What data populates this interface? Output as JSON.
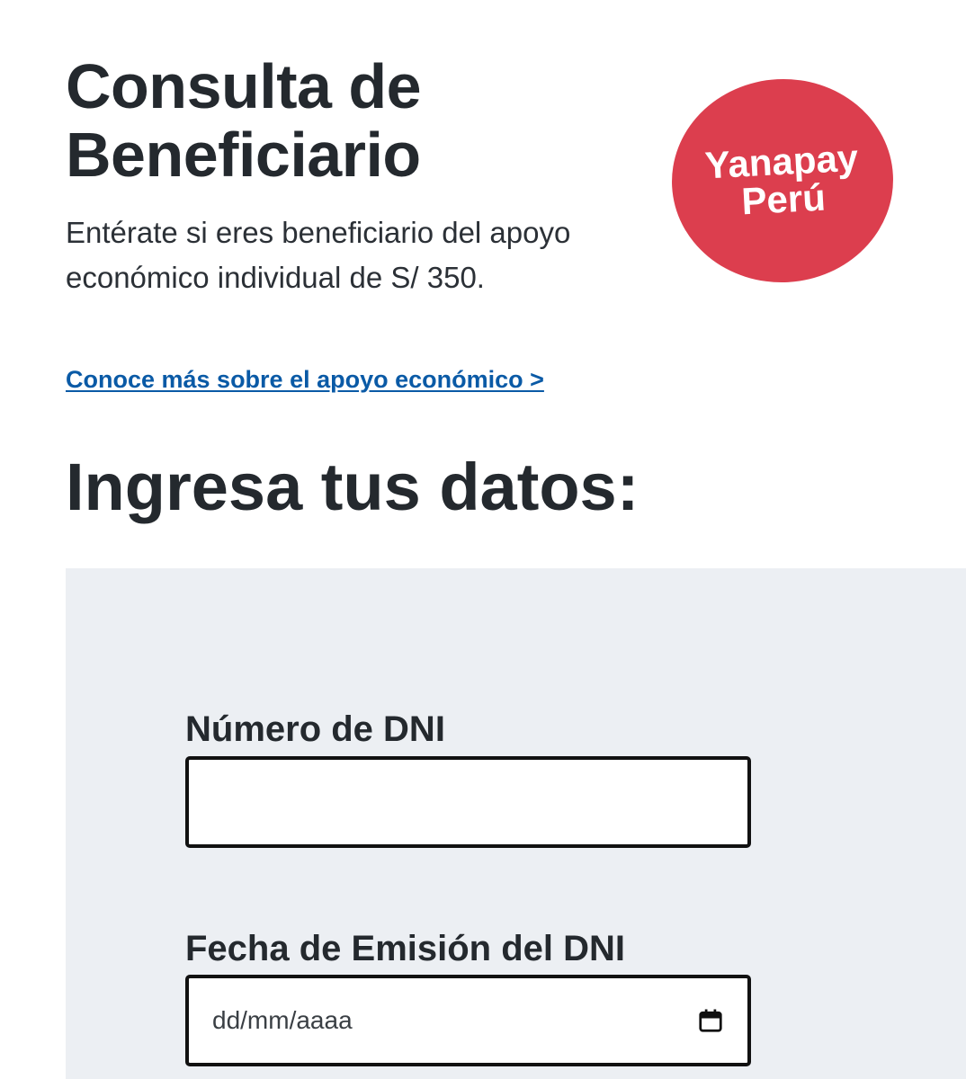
{
  "header": {
    "title": "Consulta de Beneficiario",
    "subtitle": "Entérate si eres beneficiario del apoyo económico individual de S/ 350.",
    "link_text": "Conoce más sobre el apoyo económico >"
  },
  "logo": {
    "line1": "Yanapay",
    "line2": "Perú",
    "color": "#dc3e4e"
  },
  "form": {
    "section_title": "Ingresa tus datos:",
    "dni_label": "Número de DNI",
    "dni_value": "",
    "fecha_label": "Fecha de Emisión del DNI",
    "fecha_placeholder": "dd/mm/aaaa",
    "calendar_icon": "calendar-icon"
  },
  "colors": {
    "link": "#0a5aa6",
    "panel_background": "#eceff3",
    "text": "#24292e"
  }
}
